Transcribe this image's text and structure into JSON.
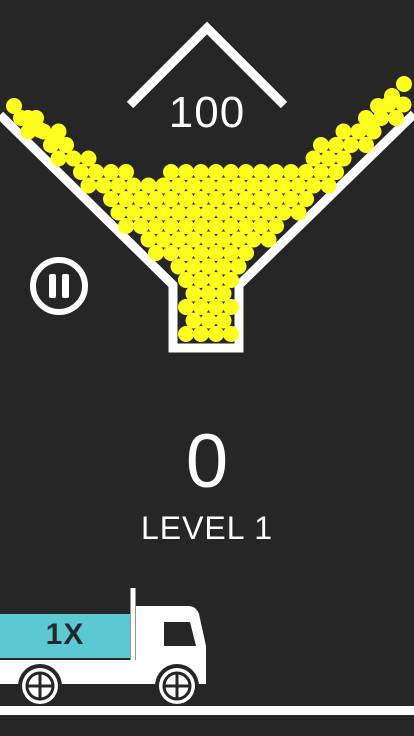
{
  "hud": {
    "target": "100",
    "score": "0",
    "level": "LEVEL 1"
  },
  "truck": {
    "multiplier": "1X"
  },
  "icons": {
    "pause": "pause-icon",
    "target_marker": "chevron-up-icon"
  },
  "colors": {
    "background": "#262626",
    "balls": "#ffff1f",
    "lines": "#ffffff",
    "truck_bed": "#5bc8d2"
  }
}
